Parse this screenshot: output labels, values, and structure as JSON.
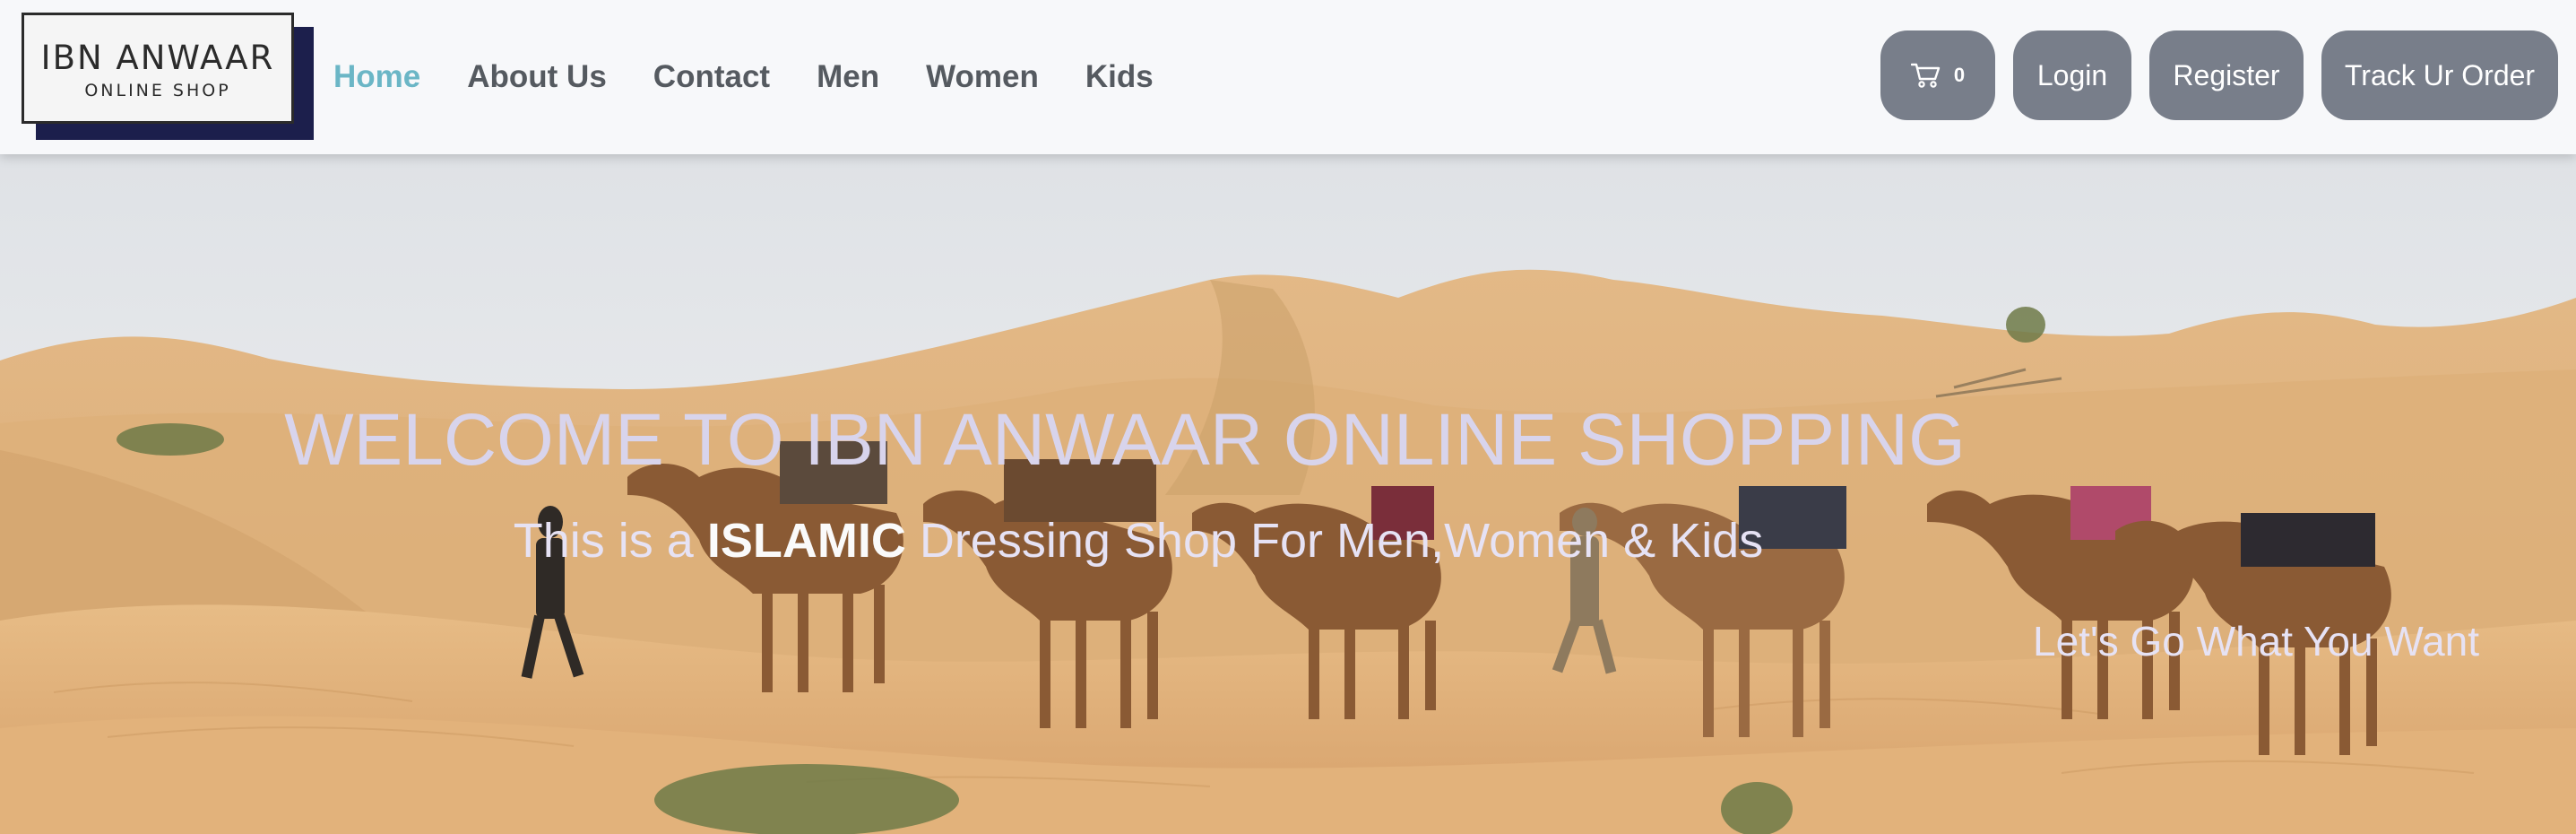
{
  "logo": {
    "title": "IBN ANWAAR",
    "subtitle": "ONLINE SHOP"
  },
  "nav": {
    "items": [
      {
        "label": "Home",
        "active": true
      },
      {
        "label": "About Us",
        "active": false
      },
      {
        "label": "Contact",
        "active": false
      },
      {
        "label": "Men",
        "active": false
      },
      {
        "label": "Women",
        "active": false
      },
      {
        "label": "Kids",
        "active": false
      }
    ]
  },
  "actions": {
    "cart_icon": "cart-icon",
    "cart_count": "0",
    "login_label": "Login",
    "register_label": "Register",
    "track_label": "Track Ur Order"
  },
  "hero": {
    "title": "WELCOME TO IBN ANWAAR ONLINE SHOPPING",
    "subtitle_pre": "This is a ",
    "subtitle_bold": "ISLAMIC",
    "subtitle_post": " Dressing Shop For Men,Women & Kids",
    "tagline": "Let's Go What You Want",
    "background": "desert camel caravan photo"
  },
  "colors": {
    "active_link": "#6bb6c6",
    "nav_link": "#555a60",
    "button_bg": "#787e8a",
    "logo_shadow": "#1c1f4c",
    "hero_text": "#d8d4ec"
  }
}
